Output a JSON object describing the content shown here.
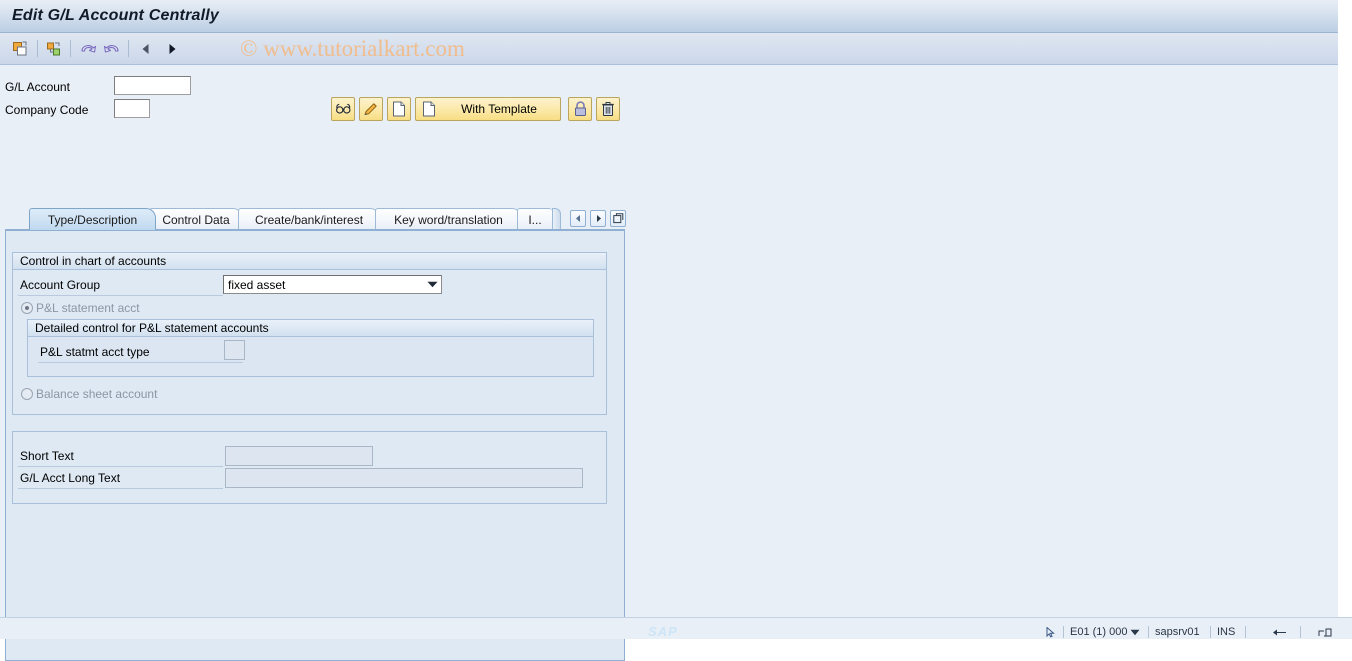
{
  "window": {
    "title": "Edit G/L Account Centrally"
  },
  "watermark": {
    "text": "© www.tutorialkart.com",
    "color": "#f0bd8e"
  },
  "toolbar": {
    "items": [
      {
        "name": "create-copy-icon",
        "tooltip": "Create"
      },
      {
        "name": "hierarchy-icon",
        "tooltip": "Chart of Accounts"
      },
      {
        "name": "undo-icon",
        "tooltip": "Undo"
      },
      {
        "name": "redo-icon",
        "tooltip": "Redo"
      },
      {
        "name": "back-triangle-icon",
        "tooltip": "Previous"
      },
      {
        "name": "forward-triangle-icon",
        "tooltip": "Next"
      }
    ]
  },
  "header": {
    "gl_account_label": "G/L Account",
    "gl_account_value": "",
    "company_code_label": "Company Code",
    "company_code_value": ""
  },
  "actions": {
    "display_label": "",
    "change_label": "",
    "create_label": "",
    "with_template_label": "With Template",
    "block_label": "",
    "delete_label": ""
  },
  "tabs": {
    "items": [
      {
        "label": "Type/Description",
        "selected": true
      },
      {
        "label": "Control Data",
        "selected": false
      },
      {
        "label": "Create/bank/interest",
        "selected": false
      },
      {
        "label": "Key word/translation",
        "selected": false
      },
      {
        "label": "I...",
        "selected": false
      }
    ],
    "nav": {
      "prev": "◀",
      "next": "▶",
      "list": "list-icon"
    }
  },
  "control_group": {
    "title": "Control in chart of accounts",
    "account_group_label": "Account Group",
    "account_group_value": "fixed asset",
    "pl_statement_label": "P&L statement acct",
    "pl_statement_selected": true,
    "detail_group_title": "Detailed control for P&L statement accounts",
    "pl_type_label": "P&L statmt acct type",
    "pl_type_value": "",
    "balance_sheet_label": "Balance sheet account",
    "balance_sheet_selected": false
  },
  "description_group": {
    "short_text_label": "Short Text",
    "short_text_value": "",
    "long_text_label": "G/L Acct Long Text",
    "long_text_value": ""
  },
  "statusbar": {
    "system": "E01 (1) 000",
    "server": "sapsrv01",
    "mode": "INS",
    "logo": "SAP"
  }
}
